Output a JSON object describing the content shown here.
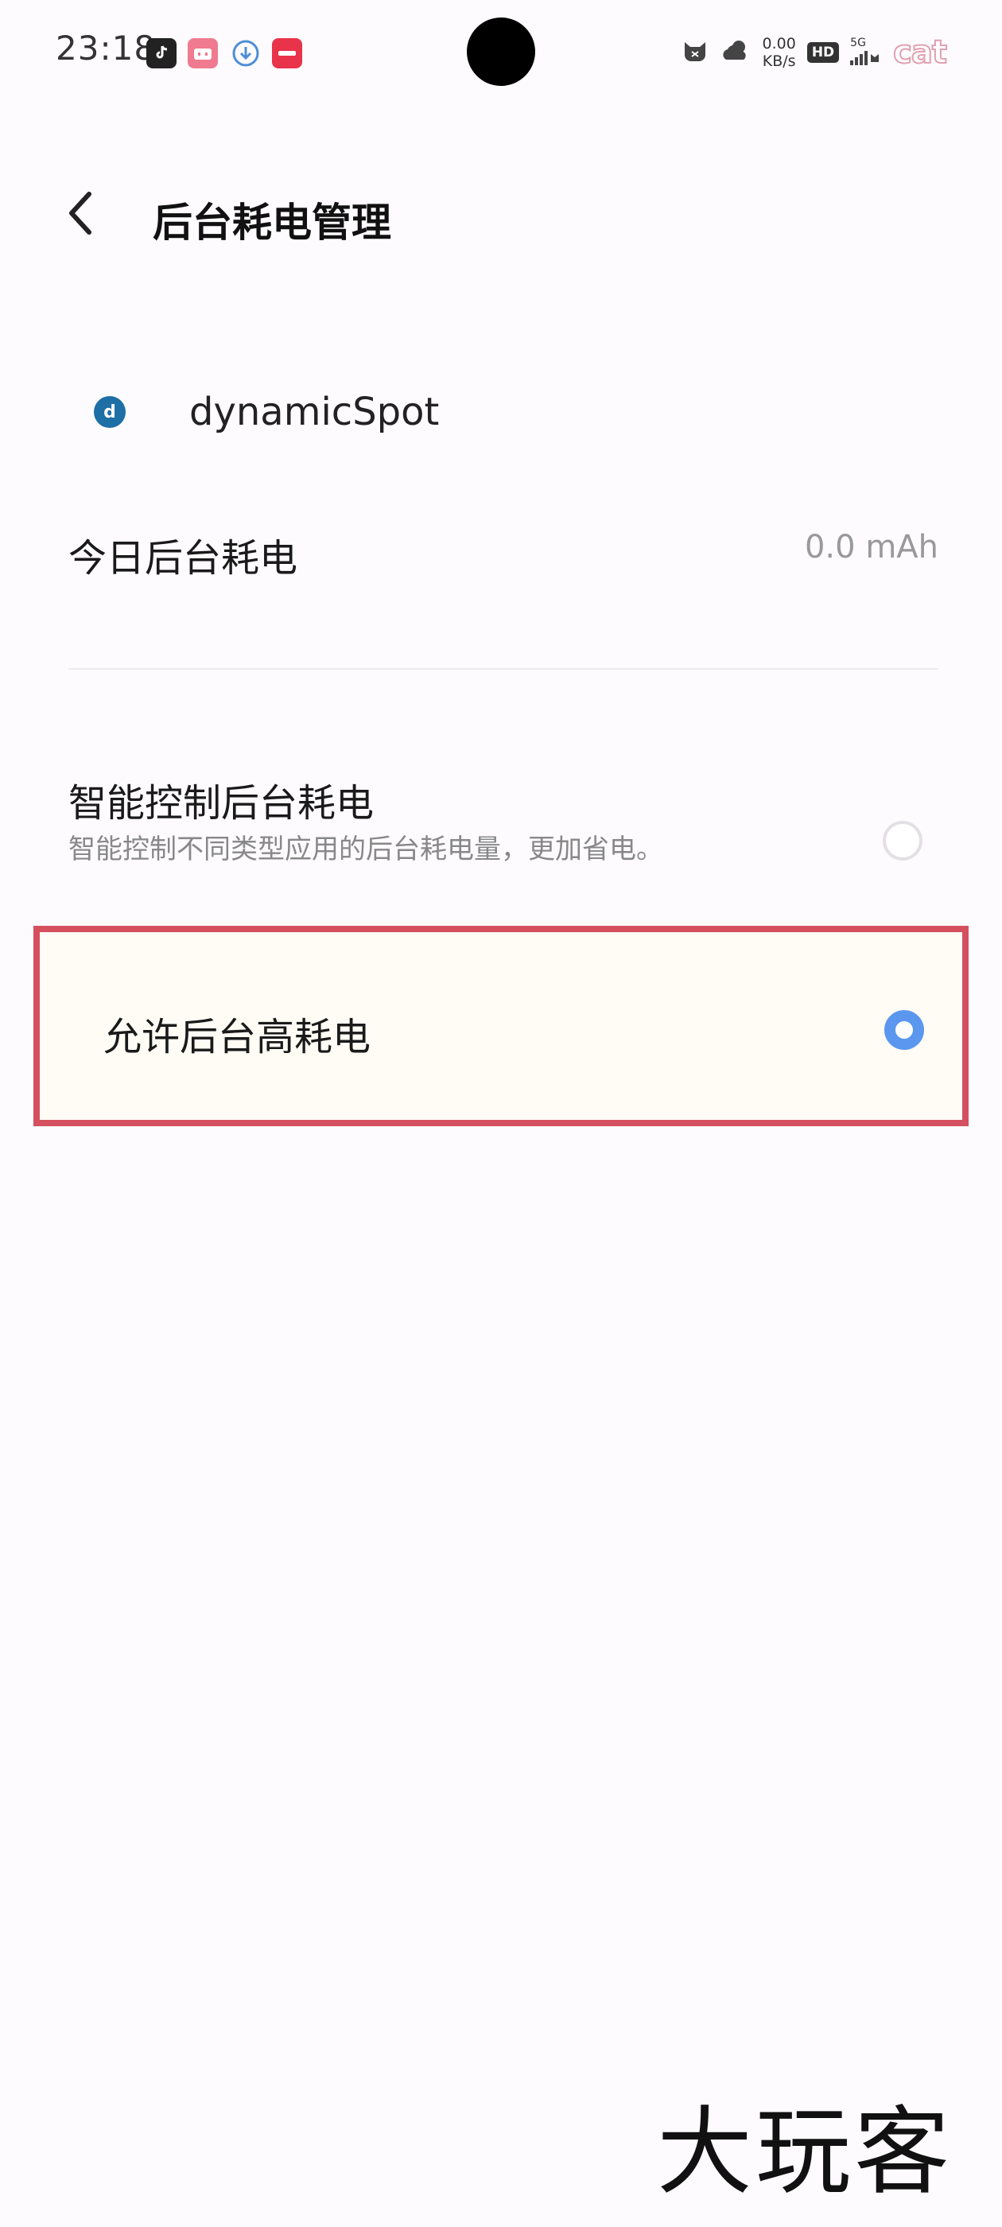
{
  "status_bar": {
    "time": "23:18",
    "net_speed_value": "0.00",
    "net_speed_unit": "KB/s",
    "hd_label": "HD",
    "signal_label": "5G",
    "battery_label": "cat"
  },
  "header": {
    "title": "后台耗电管理"
  },
  "app": {
    "name": "dynamicSpot",
    "icon_letter": "d"
  },
  "today_usage": {
    "label": "今日后台耗电",
    "value": "0.0 mAh"
  },
  "options": [
    {
      "title": "智能控制后台耗电",
      "subtitle": "智能控制不同类型应用的后台耗电量，更加省电。",
      "selected": false
    },
    {
      "title": "允许后台高耗电",
      "selected": true
    }
  ],
  "watermark": {
    "text": "大玩客"
  },
  "colors": {
    "accent": "#5b97ee",
    "highlight_border": "#d4505f",
    "background": "#fdfbfe"
  },
  "icons": {
    "back": "chevron-left-icon",
    "app": "dynamicspot-app-icon",
    "status_apps": [
      "douyin-icon",
      "bilibili-icon",
      "download-icon",
      "xiaohongshu-icon"
    ],
    "status_right": [
      "cat-face-icon",
      "weather-cloud-icon",
      "signal-icon"
    ]
  }
}
